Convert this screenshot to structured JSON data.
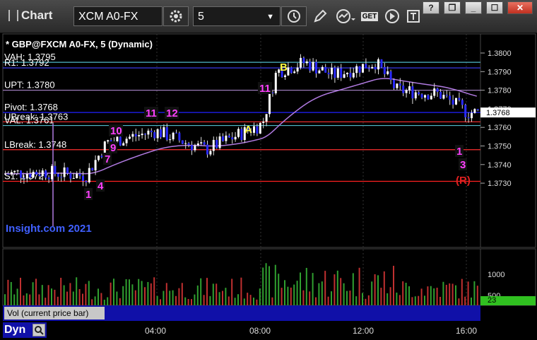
{
  "window": {
    "title": "Chart",
    "controls": [
      "?",
      "restore",
      "minimize",
      "maximize",
      "close"
    ]
  },
  "toolbar": {
    "symbol": "XCM A0-FX",
    "interval": "5",
    "get_label": "GET"
  },
  "chart": {
    "header": "* GBP@FXCM A0-FX, 5 (Dynamic)",
    "price_ticks": [
      "1.3800",
      "1.3790",
      "1.3780",
      "1.3770",
      "1.3760",
      "1.3750",
      "1.3740",
      "1.3730"
    ],
    "last_price": "1.3768",
    "levels": [
      {
        "label": "VAH: 1.3795",
        "price": 1.3795,
        "color": "#4fb8c8"
      },
      {
        "label": "R1: 1.3792",
        "price": 1.3792,
        "color": "#4040ff"
      },
      {
        "label": "UPT: 1.3780",
        "price": 1.378,
        "color": "#9a7ab8"
      },
      {
        "label": "Pivot: 1.3768",
        "price": 1.3768,
        "color": "#2020ff"
      },
      {
        "label": "UBreak: 1.3763",
        "price": 1.3763,
        "color": "#ff3030"
      },
      {
        "label": "VAL: 1.3761",
        "price": 1.3761,
        "color": "#4fb8c8"
      },
      {
        "label": "LBreak: 1.3748",
        "price": 1.3748,
        "color": "#ff3030"
      },
      {
        "label": "S1: 1.3727",
        "price": 1.3731,
        "color": "#ff2020"
      }
    ],
    "markers": [
      {
        "text": "11",
        "color": "#ff40ff"
      },
      {
        "text": "12",
        "color": "#ff40ff"
      },
      {
        "text": "10",
        "color": "#ff40ff"
      },
      {
        "text": "9",
        "color": "#ff40ff"
      },
      {
        "text": "7",
        "color": "#ff40ff"
      },
      {
        "text": "1",
        "color": "#ff40ff"
      },
      {
        "text": "4",
        "color": "#ff40ff"
      },
      {
        "text": "11",
        "color": "#ff40ff"
      },
      {
        "text": "A",
        "color": "#ffff40"
      },
      {
        "text": "B",
        "color": "#ffff40"
      },
      {
        "text": "1",
        "color": "#ff40ff"
      },
      {
        "text": "3",
        "color": "#ff40ff"
      },
      {
        "text": "(R)",
        "color": "#e02020"
      }
    ],
    "watermark": "Insight.com  2021"
  },
  "volume": {
    "label": "Vol (current price bar)",
    "ticks": [
      "1000",
      "500"
    ],
    "current": "23"
  },
  "footer": {
    "dyn_label": "Dyn",
    "times": [
      "04:00",
      "08:00",
      "12:00",
      "16:00"
    ]
  },
  "colors": {
    "candle": "#ffffff",
    "down": "#2a2aff",
    "vwap": "#b07ae0",
    "vol_up": "#c03030",
    "vol_dn": "#30a030"
  }
}
